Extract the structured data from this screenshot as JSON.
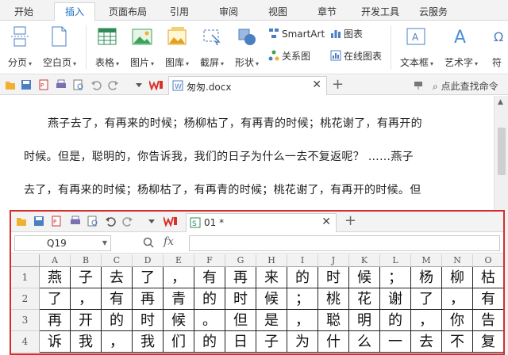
{
  "ribbon_tabs": [
    {
      "label": "开始",
      "active": false
    },
    {
      "label": "插入",
      "active": true
    },
    {
      "label": "页面布局",
      "active": false
    },
    {
      "label": "引用",
      "active": false
    },
    {
      "label": "审阅",
      "active": false
    },
    {
      "label": "视图",
      "active": false
    },
    {
      "label": "章节",
      "active": false
    },
    {
      "label": "开发工具",
      "active": false
    },
    {
      "label": "云服务",
      "active": false
    }
  ],
  "ribbon": {
    "page_break": "分页",
    "blank_page": "空白页",
    "table": "表格",
    "picture": "图片",
    "gallery": "图库",
    "screenshot": "截屏",
    "shape": "形状",
    "smartart": "SmartArt",
    "chart": "图表",
    "relation_chart": "关系图",
    "online_chart": "在线图表",
    "textbox": "文本框",
    "wordart": "艺术字",
    "symbol": "符"
  },
  "doc_toolbar": {
    "doc_tab_name": "匆匆.docx",
    "command_search": "点此查找命令"
  },
  "document": {
    "paragraphs": [
      "燕子去了，有再来的时候；杨柳枯了，有再青的时候；桃花谢了，有再开的",
      "时候。但是，聪明的，你告诉我，我们的日子为什么一去不复返呢？ ……燕子",
      "去了，有再来的时候；杨柳枯了，有再青的时候；桃花谢了，有再开的时候。但"
    ]
  },
  "sheet": {
    "tab_name": "01 *",
    "name_box": "Q19",
    "fx_label": "fx",
    "columns": [
      "A",
      "B",
      "C",
      "D",
      "E",
      "F",
      "G",
      "H",
      "I",
      "J",
      "K",
      "L",
      "M",
      "N",
      "O"
    ],
    "rows": [
      {
        "num": "1",
        "cells": [
          "燕",
          "子",
          "去",
          "了",
          "，",
          "有",
          "再",
          "来",
          "的",
          "时",
          "候",
          "；",
          "杨",
          "柳",
          "枯"
        ]
      },
      {
        "num": "2",
        "cells": [
          "了",
          "，",
          "有",
          "再",
          "青",
          "的",
          "时",
          "候",
          "；",
          "桃",
          "花",
          "谢",
          "了",
          "，",
          "有"
        ]
      },
      {
        "num": "3",
        "cells": [
          "再",
          "开",
          "的",
          "时",
          "候",
          "。",
          "但",
          "是",
          "，",
          "聪",
          "明",
          "的",
          "，",
          "你",
          "告"
        ]
      },
      {
        "num": "4",
        "cells": [
          "诉",
          "我",
          "，",
          "我",
          "们",
          "的",
          "日",
          "子",
          "为",
          "什",
          "么",
          "一",
          "去",
          "不",
          "复"
        ]
      }
    ]
  },
  "colors": {
    "accent": "#1a6fc4",
    "highlight_border": "#d32f2f",
    "wps_red": "#d9302b"
  }
}
